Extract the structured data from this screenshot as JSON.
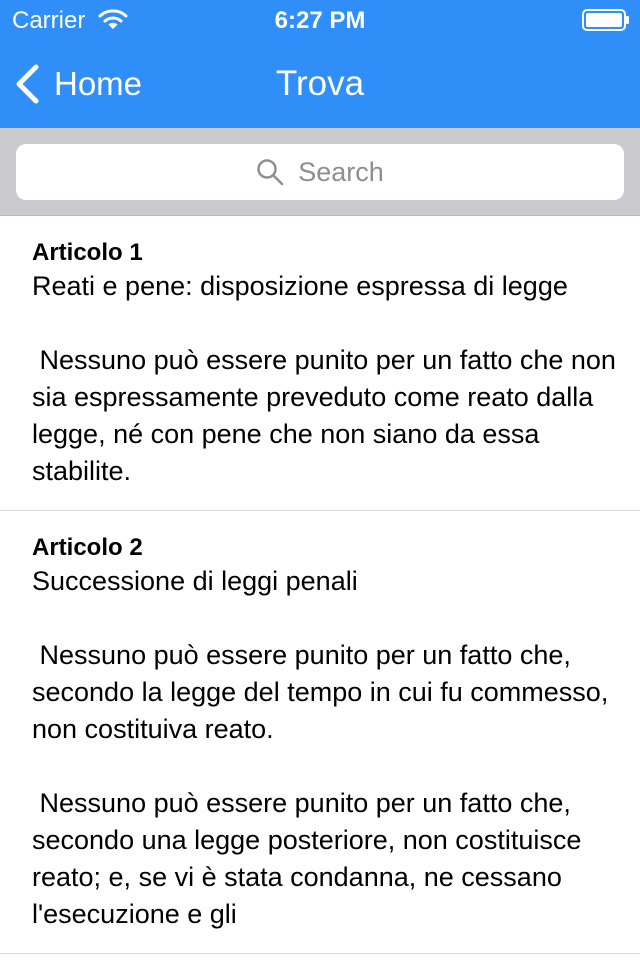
{
  "status_bar": {
    "carrier": "Carrier",
    "time": "6:27 PM"
  },
  "nav": {
    "back_label": "Home",
    "title": "Trova"
  },
  "search": {
    "placeholder": "Search"
  },
  "articles": [
    {
      "title": "Articolo 1",
      "subtitle": "Reati e pene: disposizione espressa di legge",
      "paragraphs": [
        " Nessuno può essere punito per un fatto che non sia espressamente preveduto come reato dalla legge, né con pene che non siano da essa stabilite."
      ]
    },
    {
      "title": "Articolo 2",
      "subtitle": "Successione di leggi penali",
      "paragraphs": [
        " Nessuno può essere punito per un fatto che, secondo la legge del tempo in cui fu commesso, non costituiva reato.",
        " Nessuno può essere punito per un fatto che, secondo una legge posteriore, non costituisce reato; e, se vi è stata condanna, ne cessano l'esecuzione e gli"
      ]
    }
  ],
  "colors": {
    "accent": "#2f8ef8",
    "search_bar_bg": "#c9c9ce",
    "placeholder": "#8e8e93"
  },
  "icons": [
    "wifi-icon",
    "battery-icon",
    "chevron-left-icon",
    "search-icon"
  ]
}
